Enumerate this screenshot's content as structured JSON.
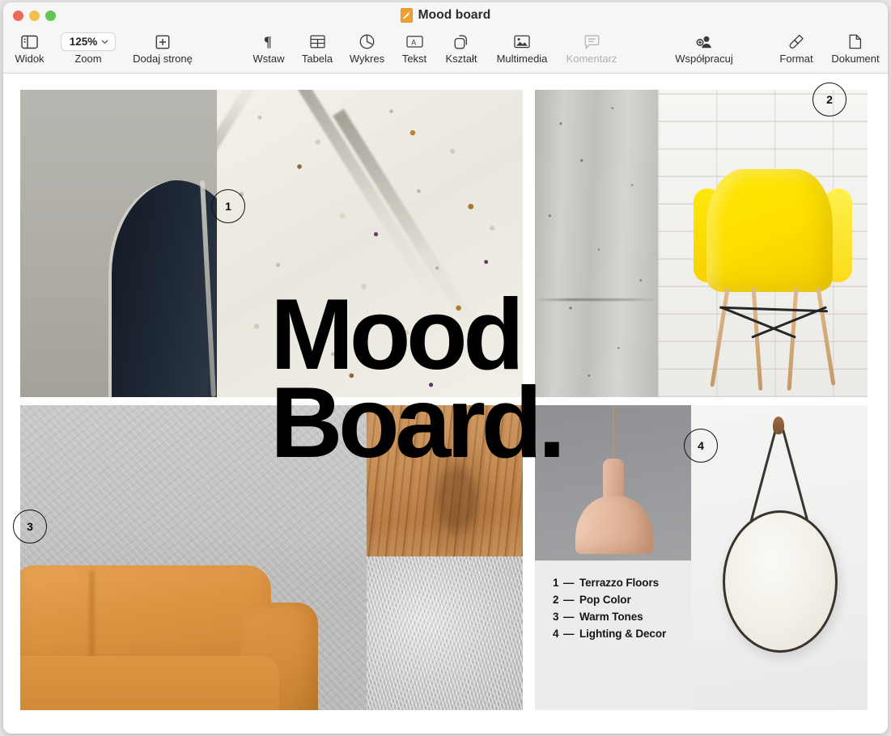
{
  "window": {
    "title": "Mood board",
    "doc_icon": "pages-document-icon",
    "traffic_lights": [
      {
        "name": "close",
        "color": "#ed6a5e"
      },
      {
        "name": "minimize",
        "color": "#f5bf4f"
      },
      {
        "name": "maximize",
        "color": "#62c554"
      }
    ]
  },
  "toolbar": {
    "items": [
      {
        "id": "view",
        "label": "Widok",
        "icon": "sidebar-icon",
        "dim": false
      },
      {
        "id": "zoom",
        "label": "Zoom",
        "icon": "zoom-popup",
        "dim": false,
        "value": "125%"
      },
      {
        "id": "add-page",
        "label": "Dodaj stronę",
        "icon": "add-page-icon",
        "dim": false
      },
      {
        "id": "insert",
        "label": "Wstaw",
        "icon": "pilcrow-icon",
        "dim": false
      },
      {
        "id": "table",
        "label": "Tabela",
        "icon": "table-icon",
        "dim": false
      },
      {
        "id": "chart",
        "label": "Wykres",
        "icon": "pie-chart-icon",
        "dim": false
      },
      {
        "id": "text",
        "label": "Tekst",
        "icon": "text-box-icon",
        "dim": false
      },
      {
        "id": "shape",
        "label": "Kształt",
        "icon": "shapes-icon",
        "dim": false
      },
      {
        "id": "media",
        "label": "Multimedia",
        "icon": "photo-icon",
        "dim": false
      },
      {
        "id": "comment",
        "label": "Komentarz",
        "icon": "comment-icon",
        "dim": true
      },
      {
        "id": "collab",
        "label": "Współpracuj",
        "icon": "add-person-icon",
        "dim": false
      },
      {
        "id": "format",
        "label": "Format",
        "icon": "paintbrush-icon",
        "dim": false
      },
      {
        "id": "document",
        "label": "Dokument",
        "icon": "document-icon",
        "dim": false
      }
    ],
    "zoom_value": "125%"
  },
  "document": {
    "headline_line1": "Mood",
    "headline_line2": "Board.",
    "badges": [
      {
        "id": 1,
        "label": "1"
      },
      {
        "id": 2,
        "label": "2"
      },
      {
        "id": 3,
        "label": "3"
      },
      {
        "id": 4,
        "label": "4"
      }
    ],
    "legend": {
      "rows": [
        {
          "num": "1",
          "dash": "—",
          "label": "Terrazzo Floors"
        },
        {
          "num": "2",
          "dash": "—",
          "label": "Pop Color"
        },
        {
          "num": "3",
          "dash": "—",
          "label": "Warm Tones"
        },
        {
          "num": "4",
          "dash": "—",
          "label": "Lighting & Decor"
        }
      ]
    },
    "images": [
      {
        "id": "armchair",
        "alt": "dark leather armchair against grey wall"
      },
      {
        "id": "terrazzo",
        "alt": "white terrazzo stone slab close-up"
      },
      {
        "id": "concrete",
        "alt": "grey concrete wall texture"
      },
      {
        "id": "yellowchair",
        "alt": "yellow moulded chair on white brick wall"
      },
      {
        "id": "sofa",
        "alt": "tan leather sofa against plaster wall"
      },
      {
        "id": "wood",
        "alt": "warm wood grain texture"
      },
      {
        "id": "fur",
        "alt": "grey faux fur rug texture"
      },
      {
        "id": "lamp",
        "alt": "blush pink pendant lamp"
      },
      {
        "id": "mirror",
        "alt": "round mirror on leather strap"
      }
    ]
  },
  "colors": {
    "accent_yellow": "#ffe600",
    "accent_tan": "#dd9543",
    "accent_blush": "#e3b79c",
    "ink": "#000000",
    "panel_grey": "#ececeb"
  }
}
